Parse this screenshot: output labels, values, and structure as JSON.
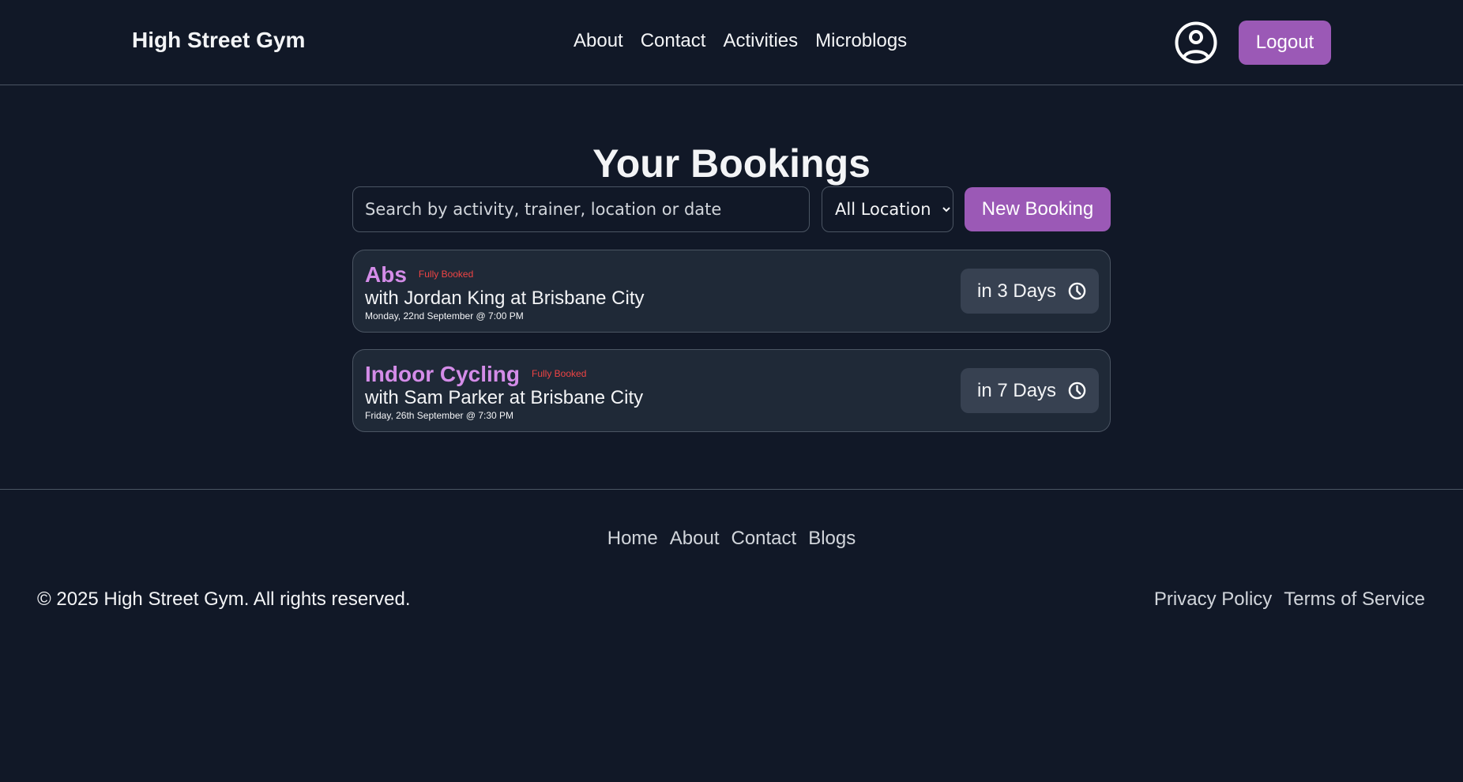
{
  "header": {
    "brand": "High Street Gym",
    "nav": [
      "About",
      "Contact",
      "Activities",
      "Microblogs"
    ],
    "user_icon": "user-circle-icon",
    "logout_label": "Logout"
  },
  "main": {
    "title": "Your Bookings",
    "search_placeholder": "Search by activity, trainer, location or date",
    "location_select": {
      "selected": "All Locations"
    },
    "new_booking_label": "New Booking",
    "bookings": [
      {
        "activity": "Abs",
        "status": "Fully Booked",
        "trainer_line": "with Jordan King at Brisbane City",
        "date": "Monday, 22nd September @ 7:00 PM",
        "countdown": "in 3 Days",
        "countdown_icon": "clock-icon"
      },
      {
        "activity": "Indoor Cycling",
        "status": "Fully Booked",
        "trainer_line": "with Sam Parker at Brisbane City",
        "date": "Friday, 26th September @ 7:30 PM",
        "countdown": "in 7 Days",
        "countdown_icon": "clock-icon"
      }
    ]
  },
  "footer": {
    "nav": [
      "Home",
      "About",
      "Contact",
      "Blogs"
    ],
    "copyright": "© 2025 High Street Gym. All rights reserved.",
    "legal": [
      "Privacy Policy",
      "Terms of Service"
    ]
  },
  "colors": {
    "background": "#111827",
    "card": "#1f2937",
    "accent": "#9b59b6",
    "activity_name": "#d48ce8",
    "status": "#ef4444"
  }
}
